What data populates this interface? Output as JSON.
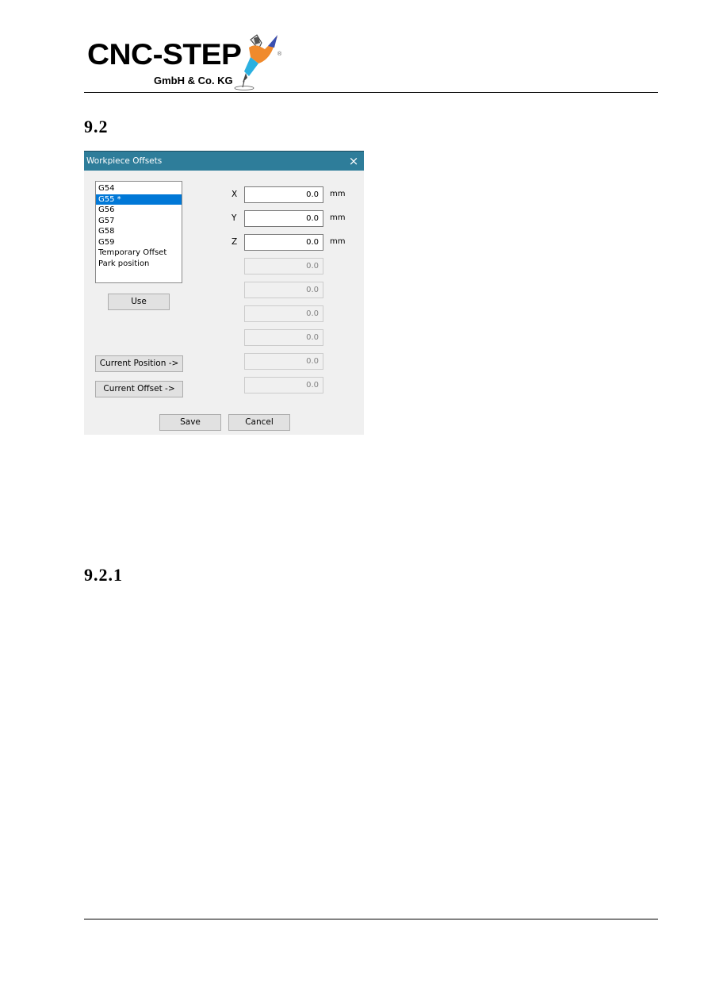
{
  "header": {
    "logo_text": "CNC-STEP",
    "logo_subtext": "GmbH & Co. KG",
    "registered_mark": "®"
  },
  "section_heading": "9.2",
  "subsection_heading": "9.2.1",
  "dialog": {
    "title": "Workpiece Offsets",
    "close_icon": "×",
    "offset_list": [
      {
        "label": "G54",
        "selected": false
      },
      {
        "label": "G55 *",
        "selected": true
      },
      {
        "label": "G56",
        "selected": false
      },
      {
        "label": "G57",
        "selected": false
      },
      {
        "label": "G58",
        "selected": false
      },
      {
        "label": "G59",
        "selected": false
      },
      {
        "label": "Temporary Offset",
        "selected": false
      },
      {
        "label": "Park position",
        "selected": false
      }
    ],
    "use_button": "Use",
    "current_position_button": "Current Position ->",
    "current_offset_button": "Current Offset ->",
    "axes": [
      {
        "label": "X",
        "value": "0.0",
        "unit": "mm"
      },
      {
        "label": "Y",
        "value": "0.0",
        "unit": "mm"
      },
      {
        "label": "Z",
        "value": "0.0",
        "unit": "mm"
      }
    ],
    "disabled_fields": [
      "0.0",
      "0.0",
      "0.0",
      "0.0",
      "0.0",
      "0.0"
    ],
    "save_button": "Save",
    "cancel_button": "Cancel",
    "titlebar_color": "#2e7d9a",
    "selection_color": "#0078d7"
  }
}
